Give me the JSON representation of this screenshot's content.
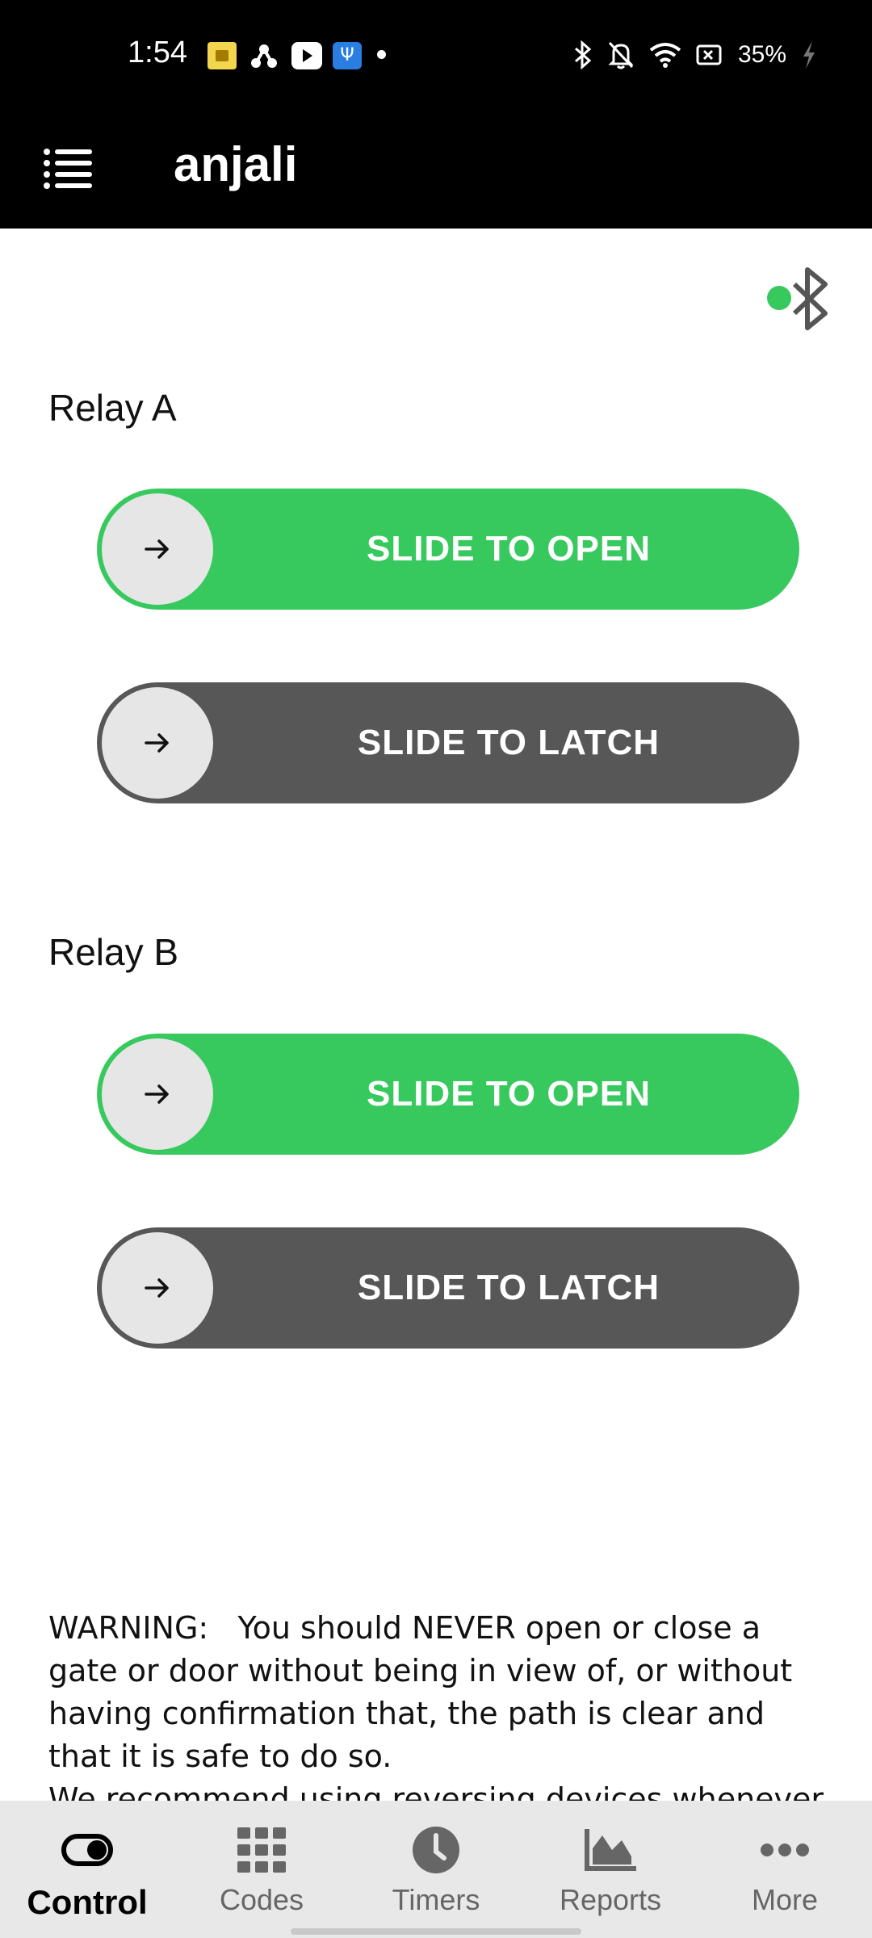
{
  "status_bar": {
    "time": "1:54",
    "battery_percent": "35%",
    "notification_icons": [
      "yellow-app-icon",
      "network-icon",
      "youtube-icon",
      "usb-icon",
      "dot-icon"
    ],
    "system_icons": [
      "bluetooth-icon",
      "bell-off-icon",
      "wifi-icon",
      "battery-saver-icon",
      "charging-icon"
    ]
  },
  "app_bar": {
    "title": "anjali",
    "menu_icon": "list-menu-icon"
  },
  "connection": {
    "icon": "bluetooth-icon",
    "connected": true,
    "indicator_color": "#38c95e"
  },
  "relays": [
    {
      "label": "Relay A",
      "open_label": "SLIDE TO OPEN",
      "latch_label": "SLIDE TO LATCH"
    },
    {
      "label": "Relay B",
      "open_label": "SLIDE TO OPEN",
      "latch_label": "SLIDE TO LATCH"
    }
  ],
  "warning": {
    "text": "WARNING:   You should NEVER open or close a gate or door without being in view of, or without having confirmation that, the path is clear and that it is safe to do so.",
    "continued": "We recommend using reversing devices whenever"
  },
  "bottom_nav": {
    "items": [
      {
        "label": "Control",
        "icon": "toggle-icon",
        "active": true
      },
      {
        "label": "Codes",
        "icon": "grid-icon",
        "active": false
      },
      {
        "label": "Timers",
        "icon": "clock-icon",
        "active": false
      },
      {
        "label": "Reports",
        "icon": "chart-icon",
        "active": false
      },
      {
        "label": "More",
        "icon": "more-dots-icon",
        "active": false
      }
    ]
  },
  "colors": {
    "green": "#38c95e",
    "dark": "#575757",
    "knob": "#e6e6e6",
    "nav_bg": "#e8e8e8"
  }
}
